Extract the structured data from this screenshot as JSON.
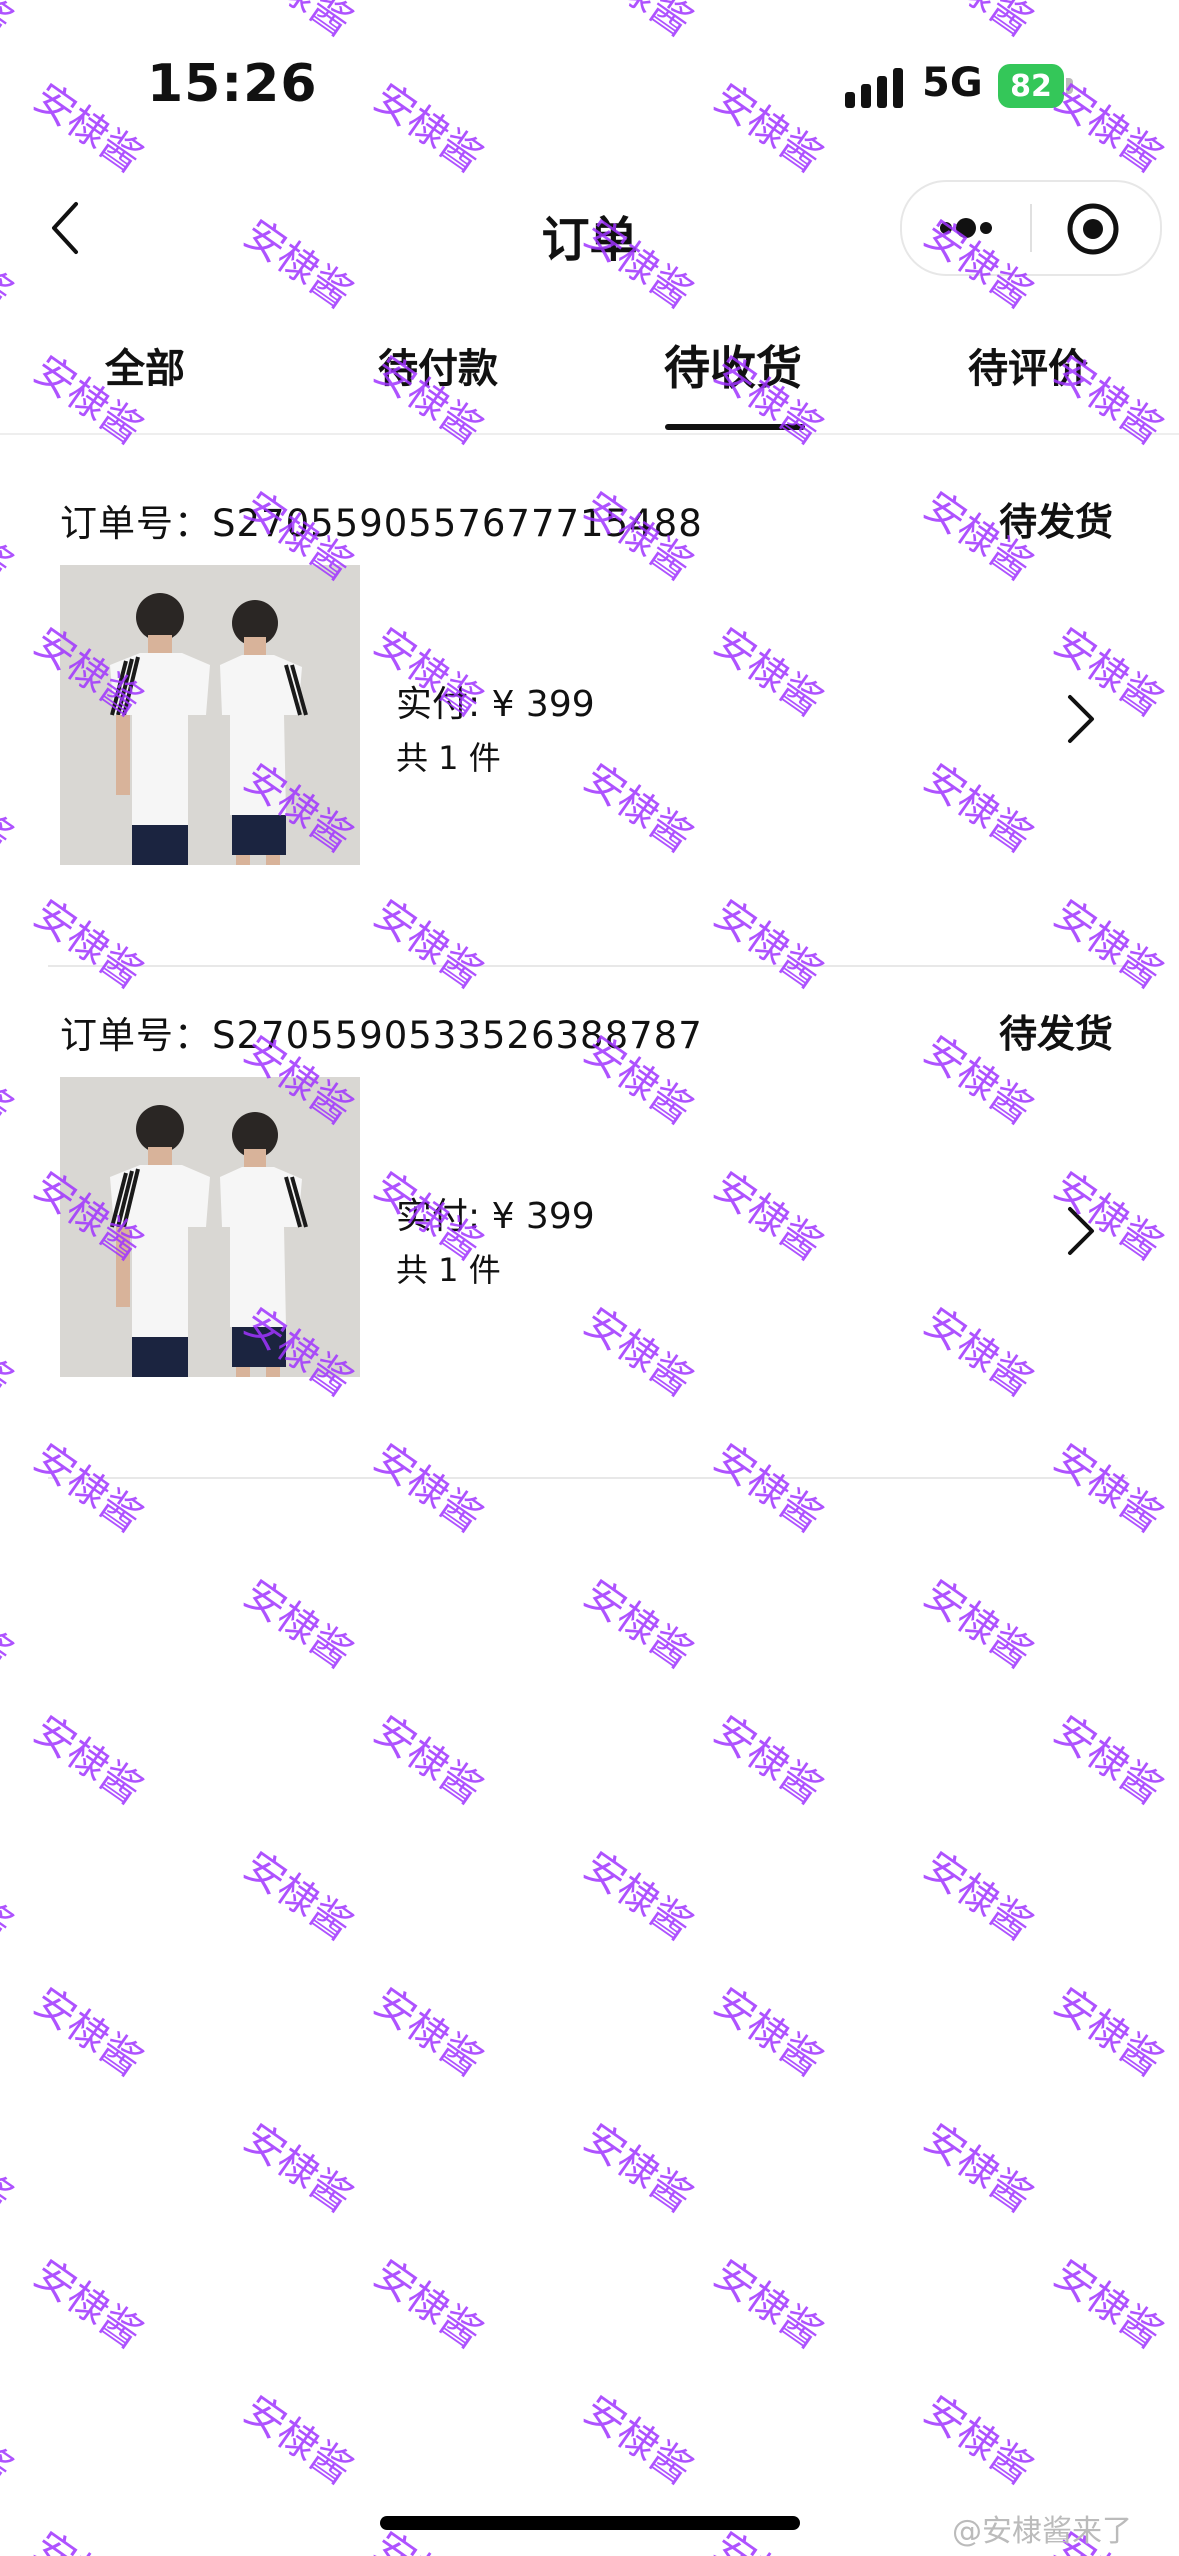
{
  "status_bar": {
    "time": "15:26",
    "network": "5G",
    "battery": "82"
  },
  "nav": {
    "title": "订单"
  },
  "tabs": [
    {
      "label": "全部",
      "active": false
    },
    {
      "label": "待付款",
      "active": false
    },
    {
      "label": "待收货",
      "active": true
    },
    {
      "label": "待评价",
      "active": false
    }
  ],
  "orders": [
    {
      "order_label": "订单号：",
      "order_no": "S270559055767771548​8",
      "status": "待发货",
      "paid": "实付: ¥ 399",
      "qty": "共 1 件"
    },
    {
      "order_label": "订单号：",
      "order_no": "S270559053352638878​7",
      "status": "待发货",
      "paid": "实付: ¥ 399",
      "qty": "共 1 件"
    }
  ],
  "watermark": "安棣酱",
  "credit": "@安棣酱来了",
  "colors": {
    "battery": "#34c759",
    "watermark": "#a034ff"
  },
  "icons": [
    "back-icon",
    "more-dots-icon",
    "target-icon",
    "chevron-right-icon",
    "signal-icon",
    "battery-icon"
  ]
}
